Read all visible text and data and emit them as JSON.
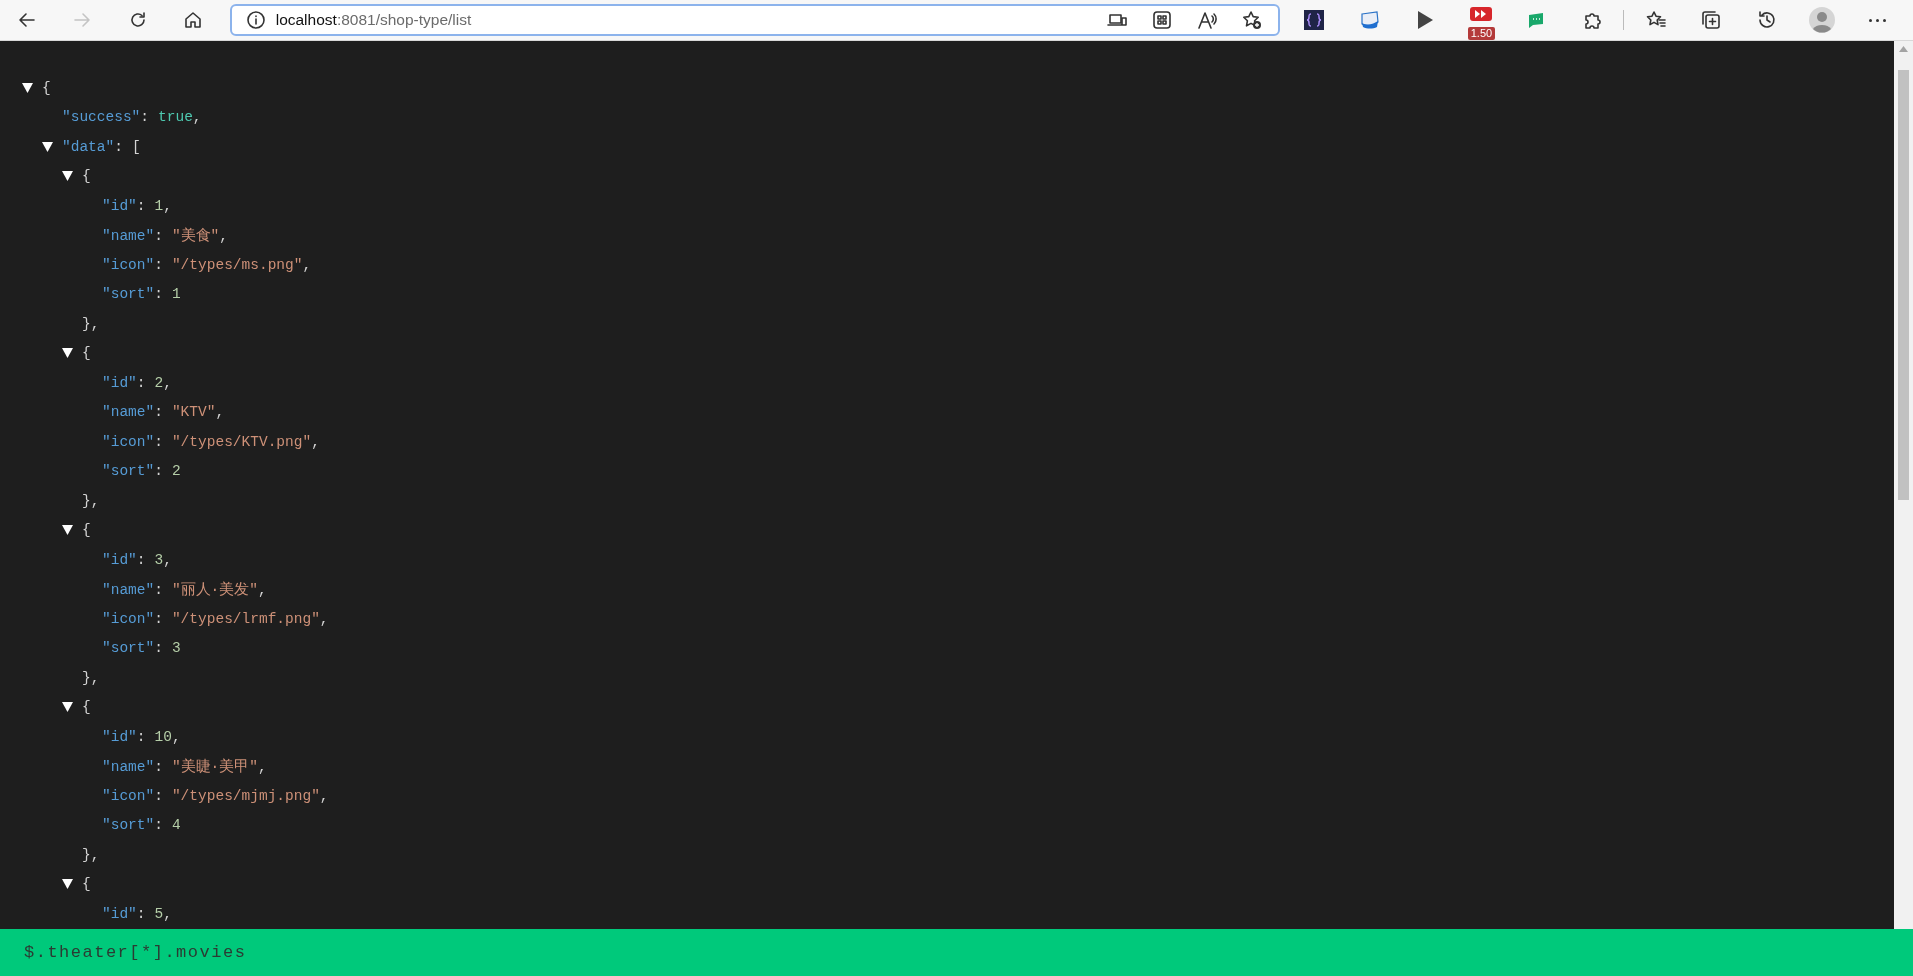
{
  "browser": {
    "url_host": "localhost",
    "url_path": ":8081/shop-type/list",
    "forward_disabled": true,
    "speed_badge": "1.50"
  },
  "document": {
    "root": {
      "expanded": true,
      "open": "{",
      "children": [
        {
          "key": "\"success\"",
          "sep": ":",
          "value": "true",
          "kind": "boolean",
          "end": ","
        },
        {
          "key": "\"data\"",
          "sep": ":",
          "expanded": true,
          "open": "[",
          "children": [
            {
              "expanded": true,
              "open": "{",
              "close": "},",
              "children": [
                {
                  "key": "\"id\"",
                  "sep": ":",
                  "value": "1",
                  "kind": "number",
                  "end": ","
                },
                {
                  "key": "\"name\"",
                  "sep": ":",
                  "value": "\"美食\"",
                  "kind": "string",
                  "end": ","
                },
                {
                  "key": "\"icon\"",
                  "sep": ":",
                  "value": "\"/types/ms.png\"",
                  "kind": "string",
                  "end": ","
                },
                {
                  "key": "\"sort\"",
                  "sep": ":",
                  "value": "1",
                  "kind": "number"
                }
              ]
            },
            {
              "expanded": true,
              "open": "{",
              "close": "},",
              "children": [
                {
                  "key": "\"id\"",
                  "sep": ":",
                  "value": "2",
                  "kind": "number",
                  "end": ","
                },
                {
                  "key": "\"name\"",
                  "sep": ":",
                  "value": "\"KTV\"",
                  "kind": "string",
                  "end": ","
                },
                {
                  "key": "\"icon\"",
                  "sep": ":",
                  "value": "\"/types/KTV.png\"",
                  "kind": "string",
                  "end": ","
                },
                {
                  "key": "\"sort\"",
                  "sep": ":",
                  "value": "2",
                  "kind": "number"
                }
              ]
            },
            {
              "expanded": true,
              "open": "{",
              "close": "},",
              "children": [
                {
                  "key": "\"id\"",
                  "sep": ":",
                  "value": "3",
                  "kind": "number",
                  "end": ","
                },
                {
                  "key": "\"name\"",
                  "sep": ":",
                  "value": "\"丽人·美发\"",
                  "kind": "string",
                  "end": ","
                },
                {
                  "key": "\"icon\"",
                  "sep": ":",
                  "value": "\"/types/lrmf.png\"",
                  "kind": "string",
                  "end": ","
                },
                {
                  "key": "\"sort\"",
                  "sep": ":",
                  "value": "3",
                  "kind": "number"
                }
              ]
            },
            {
              "expanded": true,
              "open": "{",
              "close": "},",
              "children": [
                {
                  "key": "\"id\"",
                  "sep": ":",
                  "value": "10",
                  "kind": "number",
                  "end": ","
                },
                {
                  "key": "\"name\"",
                  "sep": ":",
                  "value": "\"美睫·美甲\"",
                  "kind": "string",
                  "end": ","
                },
                {
                  "key": "\"icon\"",
                  "sep": ":",
                  "value": "\"/types/mjmj.png\"",
                  "kind": "string",
                  "end": ","
                },
                {
                  "key": "\"sort\"",
                  "sep": ":",
                  "value": "4",
                  "kind": "number"
                }
              ]
            },
            {
              "expanded": true,
              "open": "{",
              "children": [
                {
                  "key": "\"id\"",
                  "sep": ":",
                  "value": "5",
                  "kind": "number",
                  "end": ","
                }
              ]
            }
          ]
        }
      ]
    }
  },
  "status_bar": {
    "path": "$.theater[*].movies"
  }
}
